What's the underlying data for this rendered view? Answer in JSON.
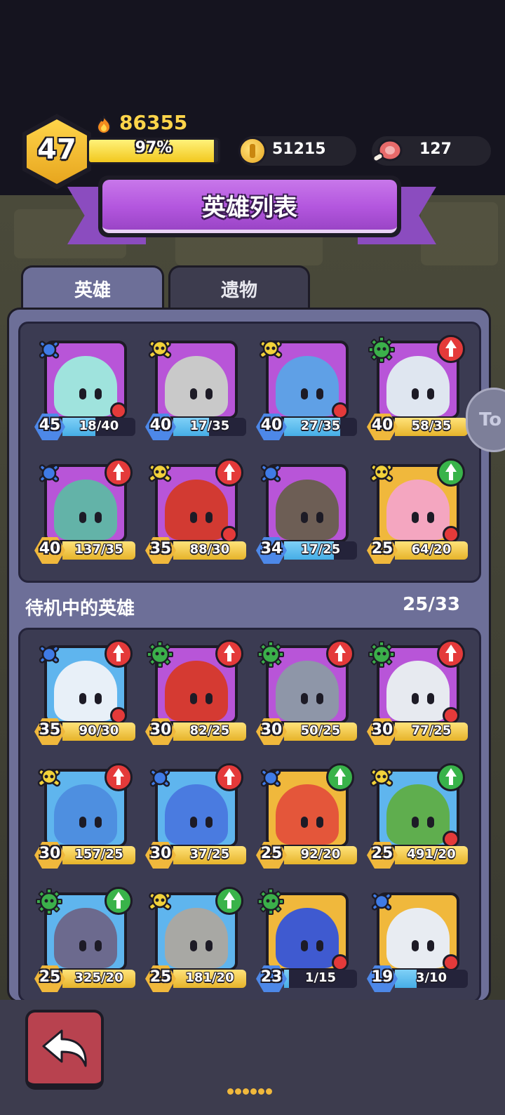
{
  "header": {
    "level": "47",
    "power": "86355",
    "exp_percent": "97%",
    "exp_fraction": 0.97,
    "coins": "51215",
    "meat": "127"
  },
  "title": "英雄列表",
  "tabs": [
    {
      "label": "英雄",
      "active": true
    },
    {
      "label": "遗物",
      "active": false
    }
  ],
  "side_chip": "To",
  "team_heroes": [
    {
      "level": "45",
      "shards": "18/40",
      "frame": "purple",
      "class": "magic",
      "badge": null,
      "dot": true,
      "full": false,
      "progress": 0.45,
      "face": "#9fe3dd"
    },
    {
      "level": "40",
      "shards": "17/35",
      "frame": "purple",
      "class": "skull",
      "badge": null,
      "dot": false,
      "full": false,
      "progress": 0.49,
      "face": "#c9c9c9"
    },
    {
      "level": "40",
      "shards": "27/35",
      "frame": "purple",
      "class": "skull",
      "badge": null,
      "dot": true,
      "full": false,
      "progress": 0.77,
      "face": "#5fa0e6"
    },
    {
      "level": "40",
      "shards": "58/35",
      "frame": "purple",
      "class": "gear",
      "badge": "red",
      "dot": false,
      "full": true,
      "progress": 1,
      "face": "#dfe6f0"
    },
    {
      "level": "40",
      "shards": "137/35",
      "frame": "purple",
      "class": "magic",
      "badge": "red",
      "dot": false,
      "full": true,
      "progress": 1,
      "face": "#63b3a8"
    },
    {
      "level": "35",
      "shards": "88/30",
      "frame": "purple",
      "class": "skull",
      "badge": "red",
      "dot": true,
      "full": true,
      "progress": 1,
      "face": "#d23a32"
    },
    {
      "level": "34",
      "shards": "17/25",
      "frame": "purple",
      "class": "magic",
      "badge": null,
      "dot": false,
      "full": false,
      "progress": 0.68,
      "face": "#6d5e55"
    },
    {
      "level": "25",
      "shards": "64/20",
      "frame": "gold",
      "class": "skull",
      "badge": "green",
      "dot": true,
      "full": true,
      "progress": 1,
      "face": "#f4a6c0"
    }
  ],
  "standby": {
    "label": "待机中的英雄",
    "count": "25/33"
  },
  "standby_heroes": [
    {
      "level": "35",
      "shards": "90/30",
      "frame": "blue",
      "class": "magic",
      "badge": "red",
      "dot": true,
      "full": true,
      "progress": 1,
      "face": "#e8f0f8"
    },
    {
      "level": "30",
      "shards": "82/25",
      "frame": "purple",
      "class": "gear",
      "badge": "red",
      "dot": false,
      "full": true,
      "progress": 1,
      "face": "#d53a32"
    },
    {
      "level": "30",
      "shards": "50/25",
      "frame": "purple",
      "class": "gear",
      "badge": "red",
      "dot": false,
      "full": true,
      "progress": 1,
      "face": "#8e96a8"
    },
    {
      "level": "30",
      "shards": "77/25",
      "frame": "purple",
      "class": "gear",
      "badge": "red",
      "dot": true,
      "full": true,
      "progress": 1,
      "face": "#e7eaf0"
    },
    {
      "level": "30",
      "shards": "157/25",
      "frame": "blue",
      "class": "skull",
      "badge": "red",
      "dot": false,
      "full": true,
      "progress": 1,
      "face": "#4e8fe0"
    },
    {
      "level": "30",
      "shards": "37/25",
      "frame": "blue",
      "class": "magic",
      "badge": "red",
      "dot": false,
      "full": true,
      "progress": 1,
      "face": "#4a7be0"
    },
    {
      "level": "25",
      "shards": "92/20",
      "frame": "gold",
      "class": "magic",
      "badge": "green",
      "dot": false,
      "full": true,
      "progress": 1,
      "face": "#e4563a"
    },
    {
      "level": "25",
      "shards": "491/20",
      "frame": "blue",
      "class": "skull",
      "badge": "green",
      "dot": true,
      "full": true,
      "progress": 1,
      "face": "#5fae4e"
    },
    {
      "level": "25",
      "shards": "325/20",
      "frame": "blue",
      "class": "gear",
      "badge": "green",
      "dot": false,
      "full": true,
      "progress": 1,
      "face": "#6c6a8e"
    },
    {
      "level": "25",
      "shards": "181/20",
      "frame": "blue",
      "class": "skull",
      "badge": "green",
      "dot": false,
      "full": true,
      "progress": 1,
      "face": "#a8a8a4"
    },
    {
      "level": "23",
      "shards": "1/15",
      "frame": "gold",
      "class": "gear",
      "badge": null,
      "dot": true,
      "full": false,
      "progress": 0.07,
      "face": "#3f5ad0"
    },
    {
      "level": "19",
      "shards": "3/10",
      "frame": "gold",
      "class": "magic",
      "badge": null,
      "dot": true,
      "full": false,
      "progress": 0.3,
      "face": "#e8ecf2"
    }
  ],
  "colors": {
    "skull": "#f2d23a",
    "magic": "#3f7be6",
    "gear": "#3bb04a"
  }
}
